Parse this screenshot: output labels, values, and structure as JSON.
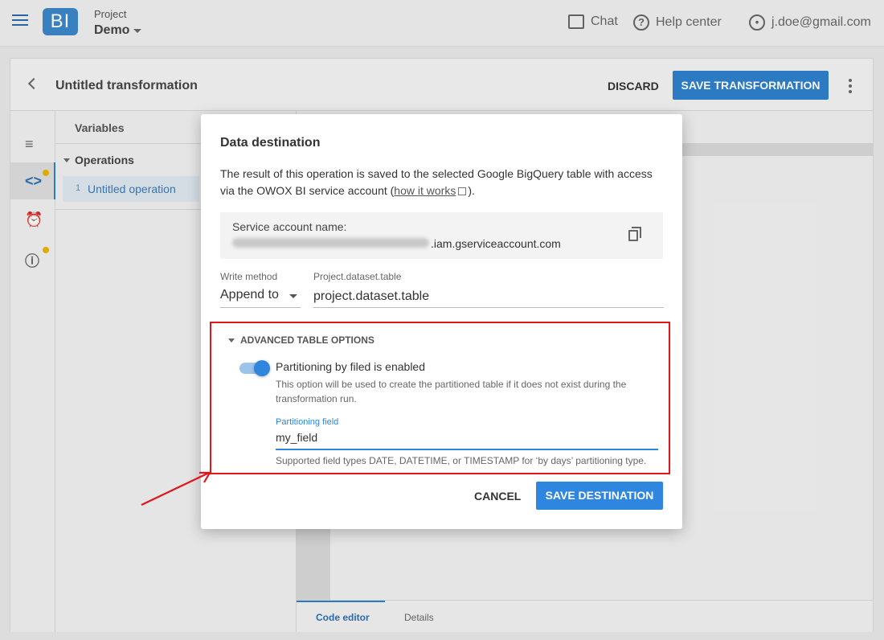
{
  "appbar": {
    "project_label": "Project",
    "project_name": "Demo",
    "chat_label": "Chat",
    "help_label": "Help center",
    "user_email": "j.doe@gmail.com",
    "logo_text": "BI"
  },
  "transformation": {
    "title": "Untitled transformation",
    "discard_label": "DISCARD",
    "save_label": "SAVE TRANSFORMATION"
  },
  "variables_panel": {
    "title": "Variables",
    "operations_title": "Operations",
    "operations": [
      {
        "number": "1",
        "label": "Untitled operation"
      }
    ]
  },
  "editor_tabs": [
    {
      "label": "Code editor",
      "active": true
    },
    {
      "label": "Details",
      "active": false
    }
  ],
  "dialog": {
    "title": "Data destination",
    "description_prefix": "The result of this operation is saved to the selected Google BigQuery table with access via the OWOX BI service account (",
    "description_link": "how it works",
    "description_suffix": ").",
    "service_account_label": "Service account name:",
    "service_account_suffix": ".iam.gserviceaccount.com",
    "write_method_label": "Write method",
    "write_method_value": "Append to",
    "table_label": "Project.dataset.table",
    "table_value": "project.dataset.table",
    "advanced_title": "ADVANCED TABLE OPTIONS",
    "partitioning_toggle_label": "Partitioning by filed is enabled",
    "partitioning_toggle_on": true,
    "partitioning_help": "This option will be used to create the partitioned table if it does not exist during the transformation run.",
    "partitioning_field_label": "Partitioning field",
    "partitioning_field_value": "my_field",
    "partitioning_field_help": "Supported field types DATE, DATETIME, or TIMESTAMP for ‘by days’ partitioning type.",
    "cancel_label": "CANCEL",
    "save_label": "SAVE DESTINATION"
  },
  "colors": {
    "primary": "#2e86de",
    "highlight_frame": "#e0161b",
    "notification_dot": "#e6b400"
  }
}
